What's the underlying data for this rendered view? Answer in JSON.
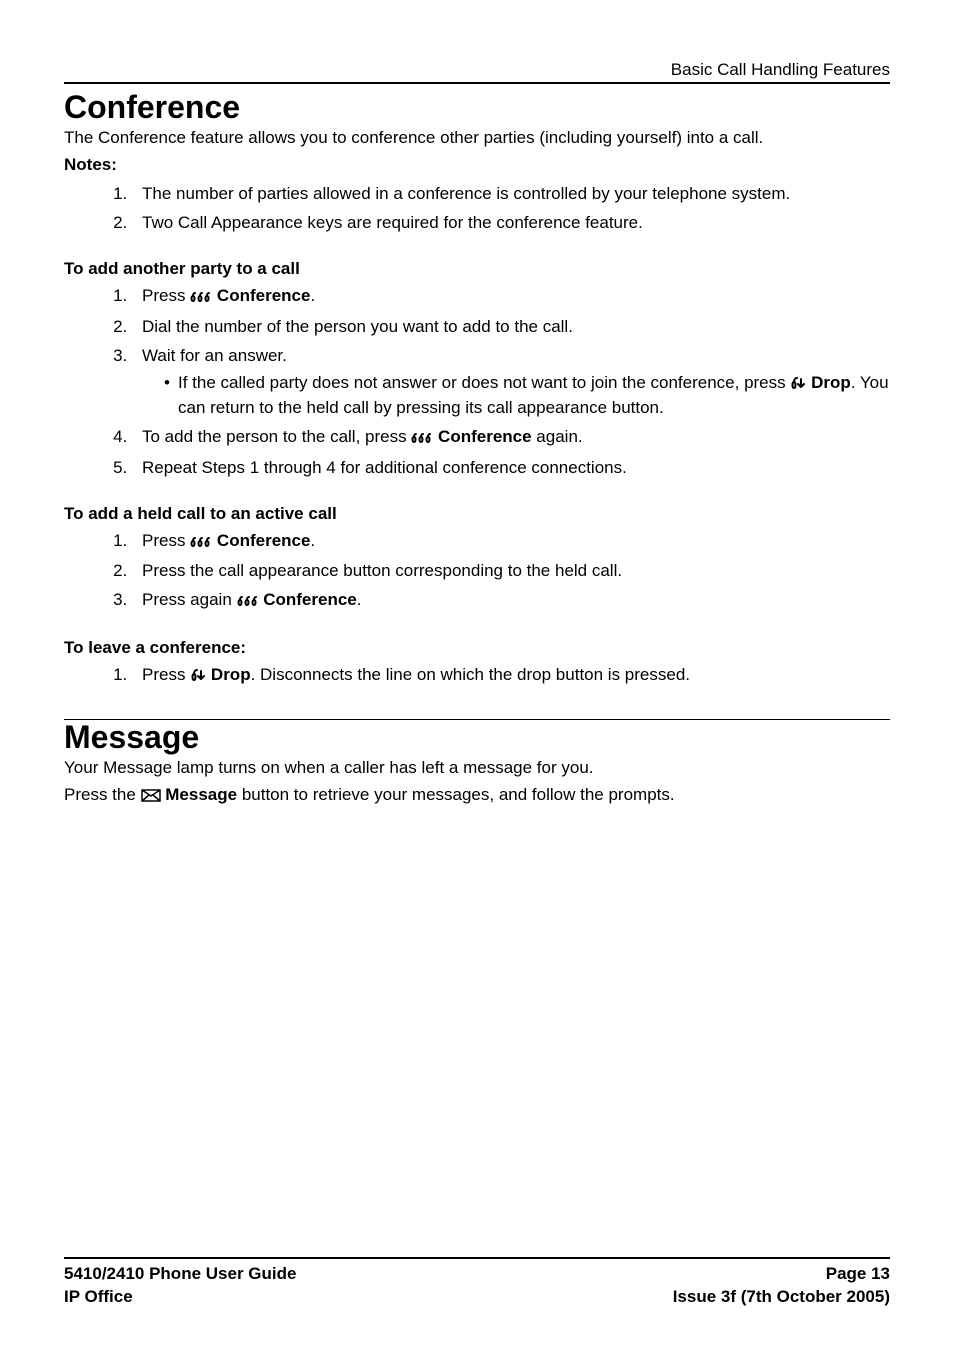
{
  "header": {
    "breadcrumb": "Basic Call Handling Features"
  },
  "conference": {
    "title": "Conference",
    "intro": "The Conference feature allows you to conference other parties (including yourself) into a call.",
    "notes_label": "Notes:",
    "notes": [
      "The number of parties allowed in a conference is controlled by your telephone system.",
      "Two Call Appearance keys are required for the conference feature."
    ],
    "add_party": {
      "heading": "To add another party to a call",
      "step1_prefix": "Press ",
      "conference_label": " Conference",
      "step1_suffix": ".",
      "step2": "Dial the number of the person you want to add to the call.",
      "step3": "Wait for an answer.",
      "step3_bullet_prefix": "If the called party does not answer or does not want to join the conference, press ",
      "drop_label": " Drop",
      "step3_bullet_suffix": ". You can return to the held call by pressing its call appearance button.",
      "step4_prefix": "To add the person to the call, press ",
      "step4_suffix": " again.",
      "step5": "Repeat Steps 1 through 4 for additional conference connections."
    },
    "add_held": {
      "heading": "To add a held call to an active call",
      "step1_prefix": "Press ",
      "step1_suffix": ".",
      "step2": "Press the call appearance button corresponding to the held call.",
      "step3_prefix": "Press again ",
      "step3_suffix": "."
    },
    "leave": {
      "heading": "To leave a conference:",
      "step1_prefix": "Press ",
      "step1_suffix": ". Disconnects the line on which the drop button is pressed."
    }
  },
  "message": {
    "title": "Message",
    "line1": "Your Message lamp turns on when a caller has left a message for you.",
    "line2_prefix": "Press the ",
    "message_label": " Message",
    "line2_suffix": " button to retrieve your messages, and follow the prompts."
  },
  "footer": {
    "left1": "5410/2410 Phone User Guide",
    "right1": "Page 13",
    "left2": "IP Office",
    "right2": "Issue 3f (7th October 2005)"
  },
  "icons": {
    "conference": "conference-icon",
    "drop": "drop-icon",
    "message": "message-icon"
  }
}
